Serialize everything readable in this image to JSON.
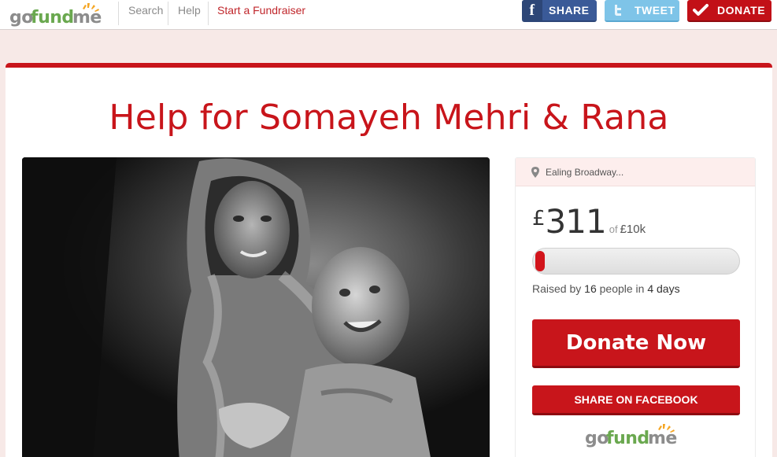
{
  "header": {
    "logo_text": "gofundme",
    "nav": {
      "search": "Search",
      "help": "Help",
      "start": "Start a Fundraiser"
    },
    "buttons": {
      "share": "SHARE",
      "tweet": "TWEET",
      "donate": "DONATE"
    }
  },
  "campaign": {
    "title": "Help for Somayeh Mehri & Rana",
    "location": "Ealing Broadway...",
    "currency": "£",
    "raised_amount": "311",
    "of_label": "of",
    "goal": "£10k",
    "progress_fraction": 0.031,
    "raised_prefix": "Raised by",
    "donor_count": "16",
    "people_in": "people in",
    "days": "4 days",
    "donate_now": "Donate Now",
    "share_facebook": "SHARE ON FACEBOOK"
  },
  "colors": {
    "brand_red": "#c8151b",
    "facebook_blue": "#3a5a98",
    "twitter_blue": "#7ec4e8",
    "logo_orange": "#f5a623",
    "logo_green": "#6aa84f"
  },
  "icons": {
    "share": "facebook-icon",
    "tweet": "twitter-icon",
    "donate": "checkmark-icon",
    "location": "map-pin-icon"
  }
}
